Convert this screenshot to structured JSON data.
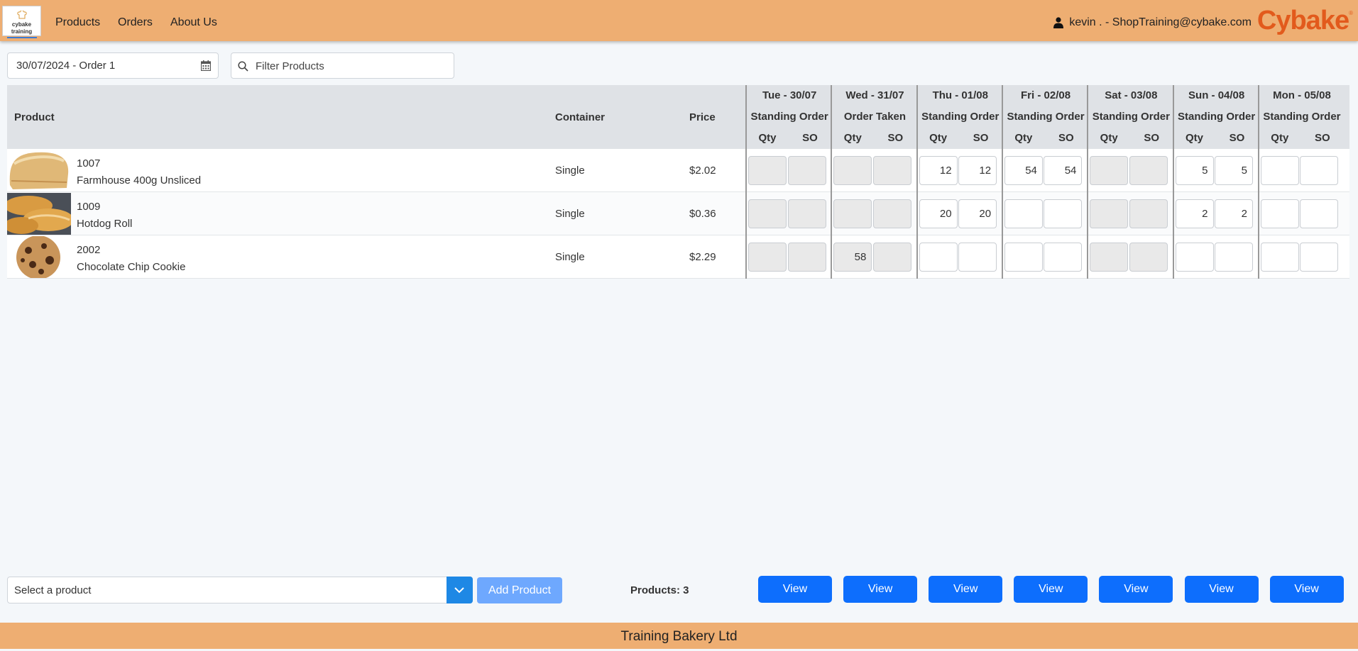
{
  "header": {
    "logo_text": "cybake training",
    "nav": [
      "Products",
      "Orders",
      "About Us"
    ],
    "user": "kevin . - ShopTraining@cybake.com",
    "brand": "Cybake",
    "brand_mark": "®"
  },
  "toolbar": {
    "date_value": "30/07/2024 - Order 1",
    "filter_placeholder": "Filter Products"
  },
  "table": {
    "headers": {
      "product": "Product",
      "container": "Container",
      "price": "Price",
      "qty": "Qty",
      "so": "SO"
    },
    "days": [
      {
        "date": "Tue - 30/07",
        "status": "Standing Order"
      },
      {
        "date": "Wed - 31/07",
        "status": "Order Taken"
      },
      {
        "date": "Thu - 01/08",
        "status": "Standing Order"
      },
      {
        "date": "Fri - 02/08",
        "status": "Standing Order"
      },
      {
        "date": "Sat - 03/08",
        "status": "Standing Order"
      },
      {
        "date": "Sun - 04/08",
        "status": "Standing Order"
      },
      {
        "date": "Mon - 05/08",
        "status": "Standing Order"
      }
    ],
    "rows": [
      {
        "code": "1007",
        "name": "Farmhouse 400g Unsliced",
        "container": "Single",
        "price": "$2.02",
        "image": "bread-loaf",
        "cells": [
          [
            "",
            ""
          ],
          [
            "",
            ""
          ],
          [
            "12",
            "12"
          ],
          [
            "54",
            "54"
          ],
          [
            "",
            ""
          ],
          [
            "5",
            "5"
          ],
          [
            "",
            ""
          ]
        ]
      },
      {
        "code": "1009",
        "name": "Hotdog Roll",
        "container": "Single",
        "price": "$0.36",
        "image": "bread-rolls",
        "cells": [
          [
            "",
            ""
          ],
          [
            "",
            ""
          ],
          [
            "20",
            "20"
          ],
          [
            "",
            ""
          ],
          [
            "",
            ""
          ],
          [
            "2",
            "2"
          ],
          [
            "",
            ""
          ]
        ]
      },
      {
        "code": "2002",
        "name": "Chocolate Chip Cookie",
        "container": "Single",
        "price": "$2.29",
        "image": "cookie",
        "cells": [
          [
            "",
            ""
          ],
          [
            "58",
            ""
          ],
          [
            "",
            ""
          ],
          [
            "",
            ""
          ],
          [
            "",
            ""
          ],
          [
            "",
            ""
          ],
          [
            "",
            ""
          ]
        ]
      }
    ],
    "disabled_days": [
      0,
      1,
      4
    ]
  },
  "bottom": {
    "select_placeholder": "Select a product",
    "add_label": "Add Product",
    "count_label": "Products: 3",
    "view_label": "View"
  },
  "footer": {
    "text": "Training Bakery Ltd"
  },
  "colors": {
    "bar": "#eeae72",
    "brand": "#e25a1c",
    "primary": "#0d6efd"
  }
}
